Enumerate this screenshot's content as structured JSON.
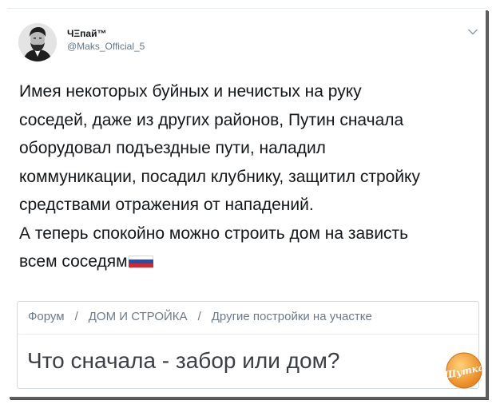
{
  "tweet": {
    "author": {
      "display_name": "ЧΞпай™",
      "handle": "@Maks_Official_5",
      "avatar_icon": "avatar-portrait"
    },
    "menu_icon": "chevron-down-icon",
    "text_lines": [
      "Имея некоторых буйных и нечистых на руку",
      "соседей, даже из других районов, Путин сначала",
      "оборудовал подъездные пути, наладил",
      "коммуникации, посадил клубнику, защитил стройку",
      "средствами отражения от нападений.",
      "А теперь спокойно можно строить дом на зависть",
      "всем соседям"
    ],
    "emoji": "russia-flag"
  },
  "card": {
    "breadcrumb": [
      "Форум",
      "ДОМ И СТРОЙКА",
      "Другие постройки на участке"
    ],
    "separator": "/",
    "title": "Что сначала - забор или дом?"
  },
  "watermark": {
    "text": "Шутка"
  },
  "colors": {
    "text": "#14171a",
    "muted": "#657786",
    "flag_white": "#ffffff",
    "flag_blue": "#1f4fb5",
    "flag_red": "#d5262d",
    "watermark_orange": "#f29a2e"
  }
}
